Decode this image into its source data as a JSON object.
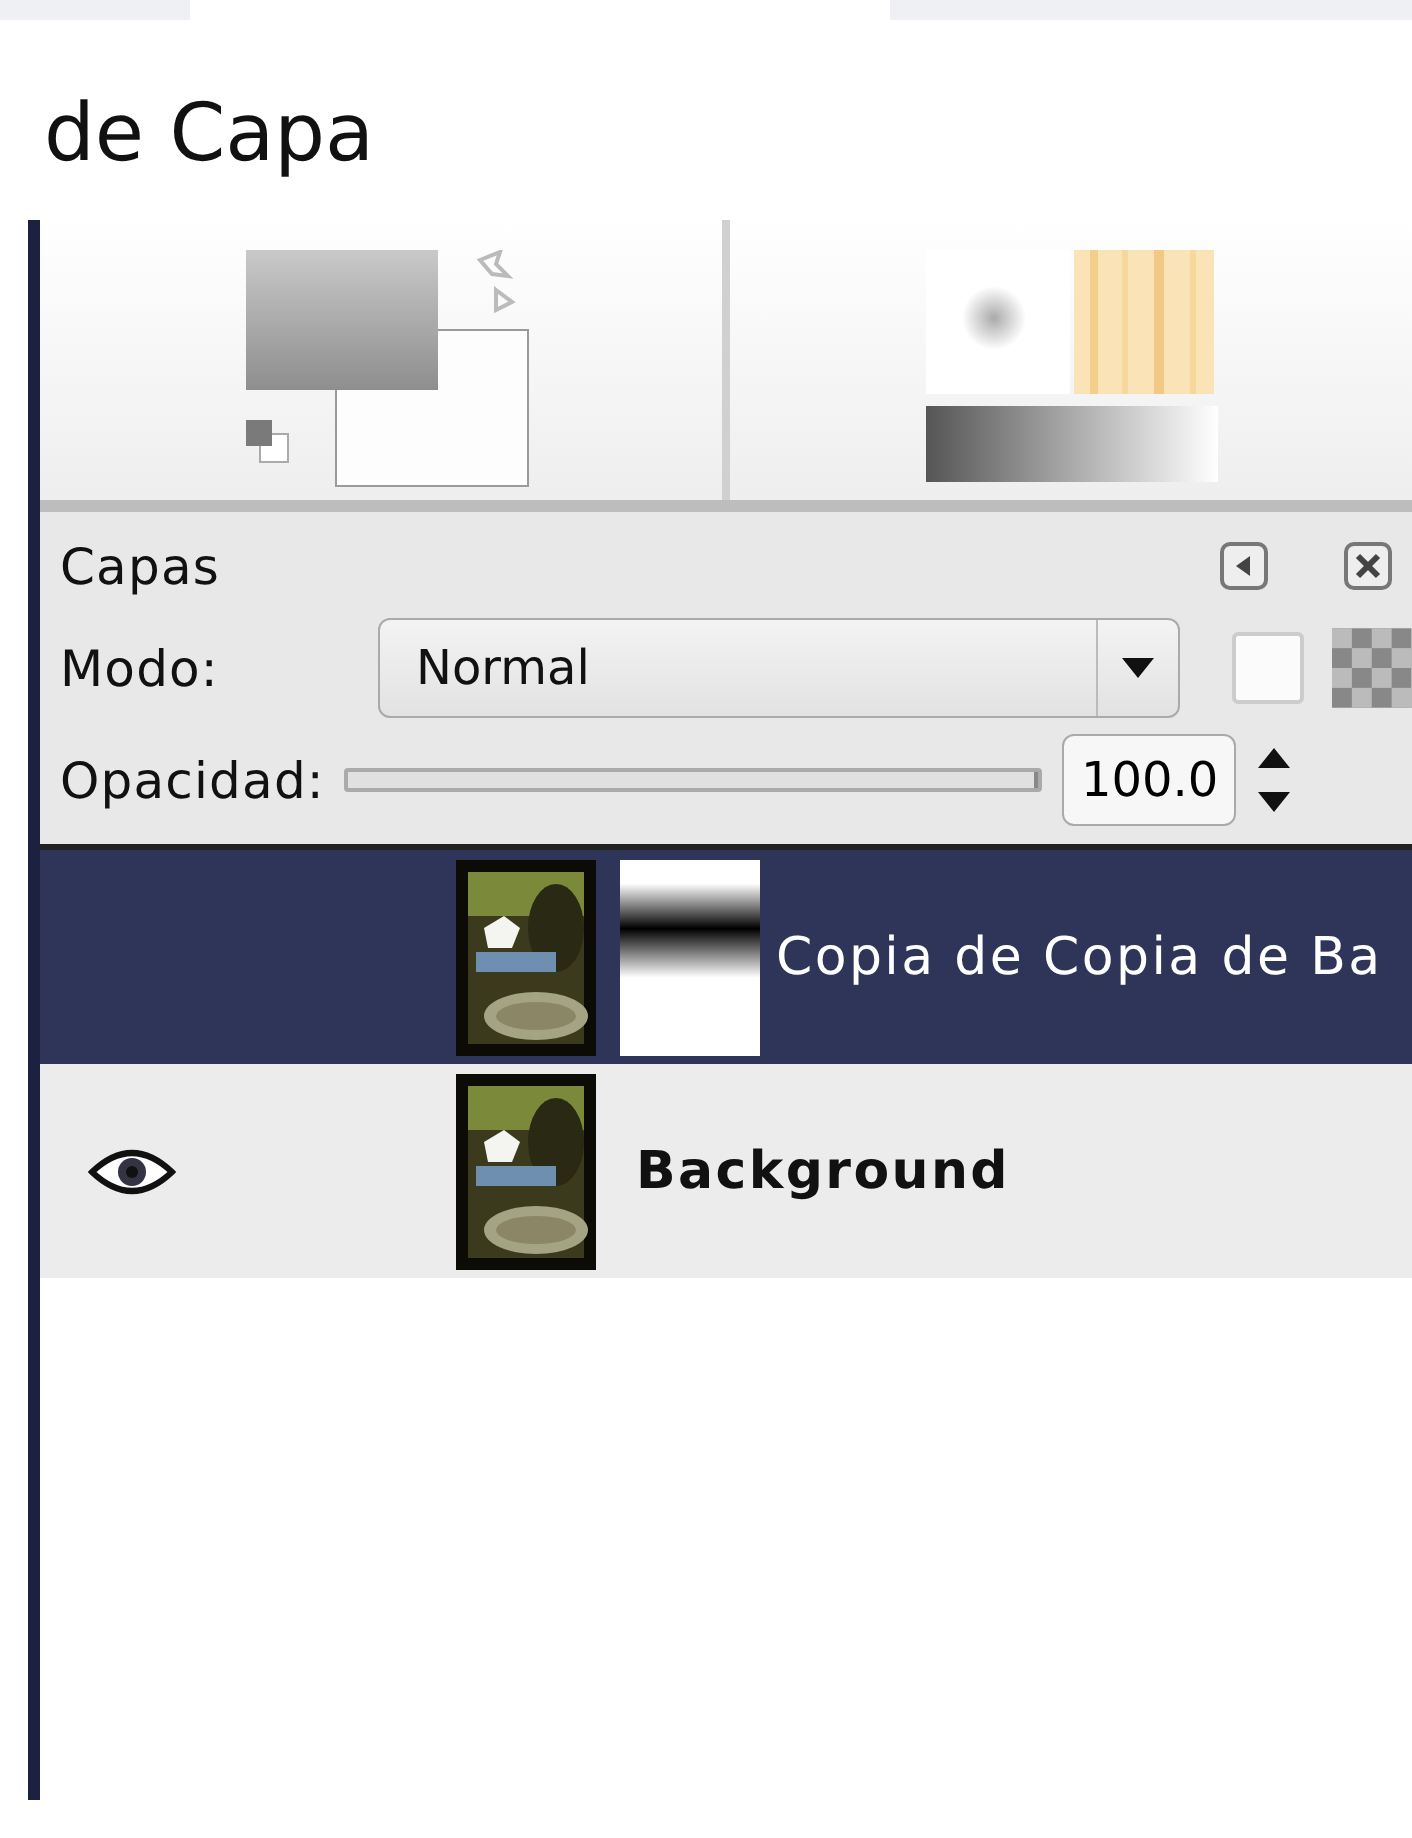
{
  "heading": "de Capa",
  "layers_dialog": {
    "title": "Capas",
    "mode_label": "Modo:",
    "mode": "Normal",
    "lock_alpha": false,
    "opacity_label": "Opacidad:",
    "opacity": {
      "level": 1.0,
      "reading": "100.0"
    }
  },
  "layers": [
    {
      "name": "Copia de Copia de Ba",
      "visible": false,
      "selected": true,
      "has_mask": true,
      "bold": false
    },
    {
      "name": "Background",
      "visible": true,
      "selected": false,
      "has_mask": false,
      "bold": true
    }
  ]
}
